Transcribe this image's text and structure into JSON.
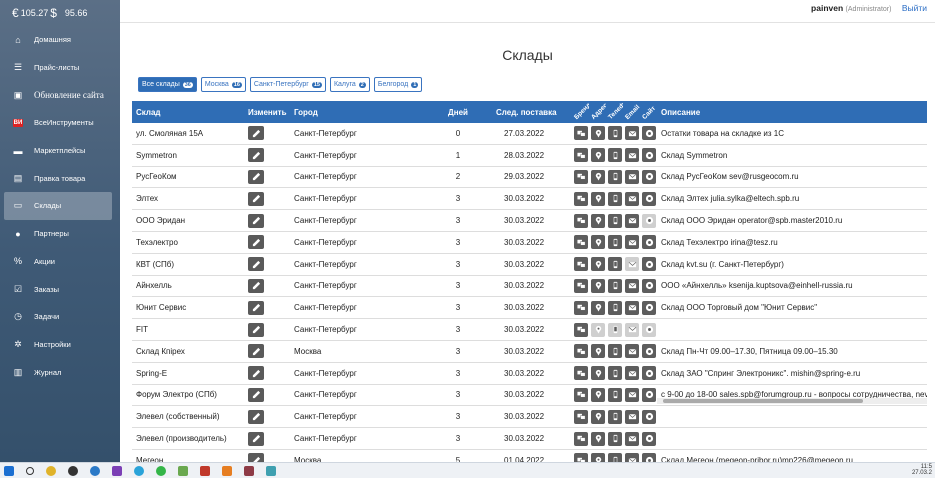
{
  "balance": {
    "value1": "105.27",
    "value2": "95.66"
  },
  "sidebar": {
    "items": [
      {
        "label": "Домашняя",
        "icon": "home-icon"
      },
      {
        "label": "Прайс-листы",
        "icon": "list-icon"
      },
      {
        "label": "Обновление сайта",
        "icon": "box-icon"
      },
      {
        "label": "ВсеИнструменты",
        "icon": "vi-logo-icon"
      },
      {
        "label": "Маркетплейсы",
        "icon": "marketplace-icon"
      },
      {
        "label": "Правка товара",
        "icon": "edit-product-icon"
      },
      {
        "label": "Склады",
        "icon": "warehouse-icon"
      },
      {
        "label": "Партнеры",
        "icon": "user-icon"
      },
      {
        "label": "Акции",
        "icon": "percent-icon"
      },
      {
        "label": "Заказы",
        "icon": "check-icon"
      },
      {
        "label": "Задачи",
        "icon": "clock-icon"
      },
      {
        "label": "Настройки",
        "icon": "gear-icon"
      },
      {
        "label": "Журнал",
        "icon": "journal-icon"
      }
    ]
  },
  "vi_badge": "ВИ",
  "topbar": {
    "username": "painven",
    "role": "(Administrator)",
    "logout": "Выйти"
  },
  "page": {
    "title": "Склады"
  },
  "filters": [
    {
      "label": "Все склады",
      "count": "36"
    },
    {
      "label": "Москва",
      "count": "16"
    },
    {
      "label": "Санкт-Петербург",
      "count": "15"
    },
    {
      "label": "Калуга",
      "count": "2"
    },
    {
      "label": "Белгород",
      "count": "1"
    }
  ],
  "table": {
    "headers": {
      "warehouse": "Склад",
      "edit": "Изменить",
      "city": "Город",
      "days": "Дней",
      "next": "След. поставка",
      "brands": "Бренды",
      "address": "Адрес",
      "phone": "Телефон",
      "email": "Email",
      "site": "Сайт",
      "desc": "Описание"
    },
    "rows": [
      {
        "name": "ул. Смоляная 15А",
        "city": "Санкт-Петербург",
        "days": "0",
        "next": "27.03.2022",
        "icons": [
          1,
          1,
          1,
          1,
          1
        ],
        "desc": "Остатки товара на складке из 1С"
      },
      {
        "name": "Symmetron",
        "city": "Санкт-Петербург",
        "days": "1",
        "next": "28.03.2022",
        "icons": [
          1,
          1,
          1,
          1,
          1
        ],
        "desc": "Склад Symmetron"
      },
      {
        "name": "РусГеоКом",
        "city": "Санкт-Петербург",
        "days": "2",
        "next": "29.03.2022",
        "icons": [
          1,
          1,
          1,
          1,
          1
        ],
        "desc": "Склад РусГеоКом sev@rusgeocom.ru"
      },
      {
        "name": "Элтех",
        "city": "Санкт-Петербург",
        "days": "3",
        "next": "30.03.2022",
        "icons": [
          1,
          1,
          1,
          1,
          1
        ],
        "desc": "Склад Элтех julia.sylka@eltech.spb.ru"
      },
      {
        "name": "ООО Эридан",
        "city": "Санкт-Петербург",
        "days": "3",
        "next": "30.03.2022",
        "icons": [
          1,
          1,
          1,
          1,
          0
        ],
        "desc": "Склад ООО Эридан operator@spb.master2010.ru"
      },
      {
        "name": "Техэлектро",
        "city": "Санкт-Петербург",
        "days": "3",
        "next": "30.03.2022",
        "icons": [
          1,
          1,
          1,
          1,
          1
        ],
        "desc": "Склад Техэлектро irina@tesz.ru"
      },
      {
        "name": "КВТ (СПб)",
        "city": "Санкт-Петербург",
        "days": "3",
        "next": "30.03.2022",
        "icons": [
          1,
          1,
          1,
          0,
          1
        ],
        "desc": "Склад kvt.su (г. Санкт-Петербург)"
      },
      {
        "name": "Айнхелль",
        "city": "Санкт-Петербург",
        "days": "3",
        "next": "30.03.2022",
        "icons": [
          1,
          1,
          1,
          1,
          1
        ],
        "desc": "ООО «Айнхелль» ksenija.kuptsova@einhell-russia.ru"
      },
      {
        "name": "Юнит Сервис",
        "city": "Санкт-Петербург",
        "days": "3",
        "next": "30.03.2022",
        "icons": [
          1,
          1,
          1,
          1,
          1
        ],
        "desc": "Склад ООО Торговый дом \"Юнит Сервис\""
      },
      {
        "name": "FIT",
        "city": "Санкт-Петербург",
        "days": "3",
        "next": "30.03.2022",
        "icons": [
          1,
          0,
          0,
          0,
          0
        ],
        "desc": ""
      },
      {
        "name": "Склад Кпiрех",
        "city": "Москва",
        "days": "3",
        "next": "30.03.2022",
        "icons": [
          1,
          1,
          1,
          1,
          1
        ],
        "desc": "Склад Пн-Чт 09.00–17.30, Пятница 09.00–15.30"
      },
      {
        "name": "Spring-E",
        "city": "Санкт-Петербург",
        "days": "3",
        "next": "30.03.2022",
        "icons": [
          1,
          1,
          1,
          1,
          1
        ],
        "desc": "Склад ЗАО \"Спринг Электроникс\". mishin@spring-e.ru"
      },
      {
        "name": "Форум Электро (СПб)",
        "city": "Санкт-Петербург",
        "days": "3",
        "next": "30.03.2022",
        "icons": [
          1,
          1,
          1,
          1,
          1
        ],
        "desc": "с 9-00 до 18-00 sales.spb@forumgroup.ru - вопросы сотрудничества, nevac"
      },
      {
        "name": "Элевел (собственный)",
        "city": "Санкт-Петербург",
        "days": "3",
        "next": "30.03.2022",
        "icons": [
          1,
          1,
          1,
          1,
          1
        ],
        "desc": ""
      },
      {
        "name": "Элевел (производитель)",
        "city": "Санкт-Петербург",
        "days": "3",
        "next": "30.03.2022",
        "icons": [
          1,
          1,
          1,
          1,
          1
        ],
        "desc": ""
      },
      {
        "name": "Мегеон",
        "city": "Москва",
        "days": "5",
        "next": "01.04.2022",
        "icons": [
          1,
          1,
          1,
          1,
          1
        ],
        "desc": "Склад Мегеон (megeon-pribor.ru)mp226@megeon.ru"
      }
    ]
  },
  "clock": {
    "time": "11:5",
    "date": "27.03.2"
  },
  "colors": {
    "accent": "#2f6db5",
    "sidebar": "#3f5a76"
  }
}
